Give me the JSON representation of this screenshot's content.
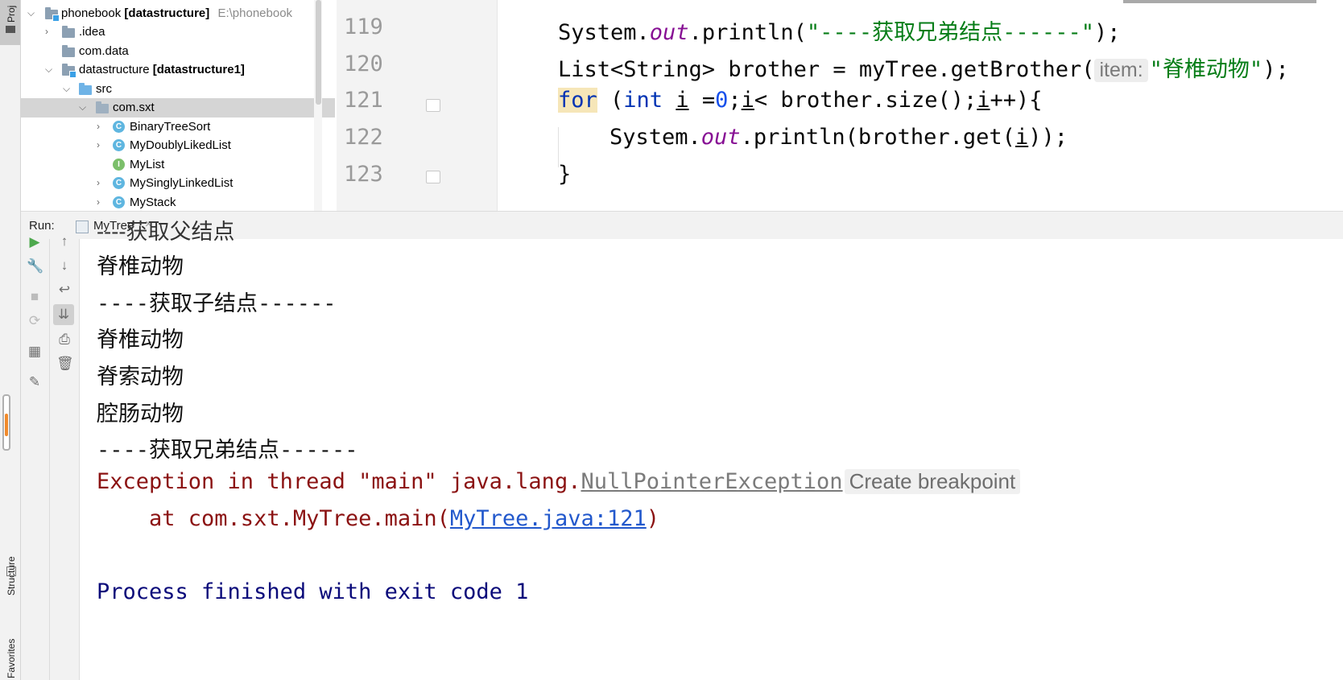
{
  "sidebar": {
    "project_label": "Proj",
    "structure_label": "Structure",
    "favorites_label": "Favorites"
  },
  "project_tree": {
    "root": {
      "name": "phonebook",
      "module": "[datastructure]",
      "path": "E:\\phonebook"
    },
    "items": [
      {
        "label": ".idea"
      },
      {
        "label": "com.data"
      },
      {
        "label": "datastructure",
        "module": "[datastructure1]"
      },
      {
        "label": "src"
      },
      {
        "label": "com.sxt"
      },
      {
        "label": "BinaryTreeSort",
        "icon_letter": "C"
      },
      {
        "label": "MyDoublyLikedList",
        "icon_letter": "C"
      },
      {
        "label": "MyList",
        "icon_letter": "I"
      },
      {
        "label": "MySinglyLinkedList",
        "icon_letter": "C"
      },
      {
        "label": "MyStack",
        "icon_letter": "C"
      }
    ]
  },
  "editor": {
    "line_numbers": [
      "119",
      "120",
      "121",
      "122",
      "123"
    ],
    "lines": {
      "l119": {
        "a": "System.",
        "b": "out",
        "c": ".println(",
        "d": "\"----获取兄弟结点------\"",
        "e": ");"
      },
      "l120": {
        "a": "List<String> brother = myTree.getBrother(",
        "hint": "item:",
        "d": "\"脊椎动物\"",
        "e": ");"
      },
      "l121": {
        "kw_for": "for",
        "a": " (",
        "kw_int": "int",
        "b": " ",
        "v1": "i",
        "c": " =",
        "n0": "0",
        "d": ";",
        "v2": "i",
        "e": "< brother.size();",
        "v3": "i",
        "f": "++){"
      },
      "l122": {
        "a": "System.",
        "b": "out",
        "c": ".println(brother.get(",
        "v": "i",
        "d": "));"
      },
      "l123": {
        "a": "}"
      }
    }
  },
  "run_panel": {
    "run_label": "Run:",
    "tab_label": "MyTree",
    "tab_close": "×",
    "console": {
      "cut_line": "----获取父结点",
      "out1": "脊椎动物",
      "header_children": "----获取子结点------",
      "out2": "脊椎动物",
      "out3": "脊索动物",
      "out4": "腔肠动物",
      "header_brothers": "----获取兄弟结点------",
      "exception_prefix": "Exception in thread \"main\" java.lang.",
      "exception_class": "NullPointerException",
      "create_breakpoint": "Create breakpoint",
      "at_prefix": "    at com.sxt.MyTree.main(",
      "at_link": "MyTree.java:121",
      "at_suffix": ")",
      "process_finished": "Process finished with exit code 1"
    }
  },
  "icons": {
    "run": "run-icon",
    "wrench": "wrench-icon",
    "stop": "stop-icon",
    "rerun": "rerun-icon",
    "layout": "layout-icon",
    "pin": "pin-icon",
    "up": "arrow-up-icon",
    "down": "arrow-down-icon",
    "soft_wrap": "soft-wrap-icon",
    "scroll_end": "scroll-to-end-icon",
    "print": "print-icon",
    "trash": "trash-icon"
  }
}
